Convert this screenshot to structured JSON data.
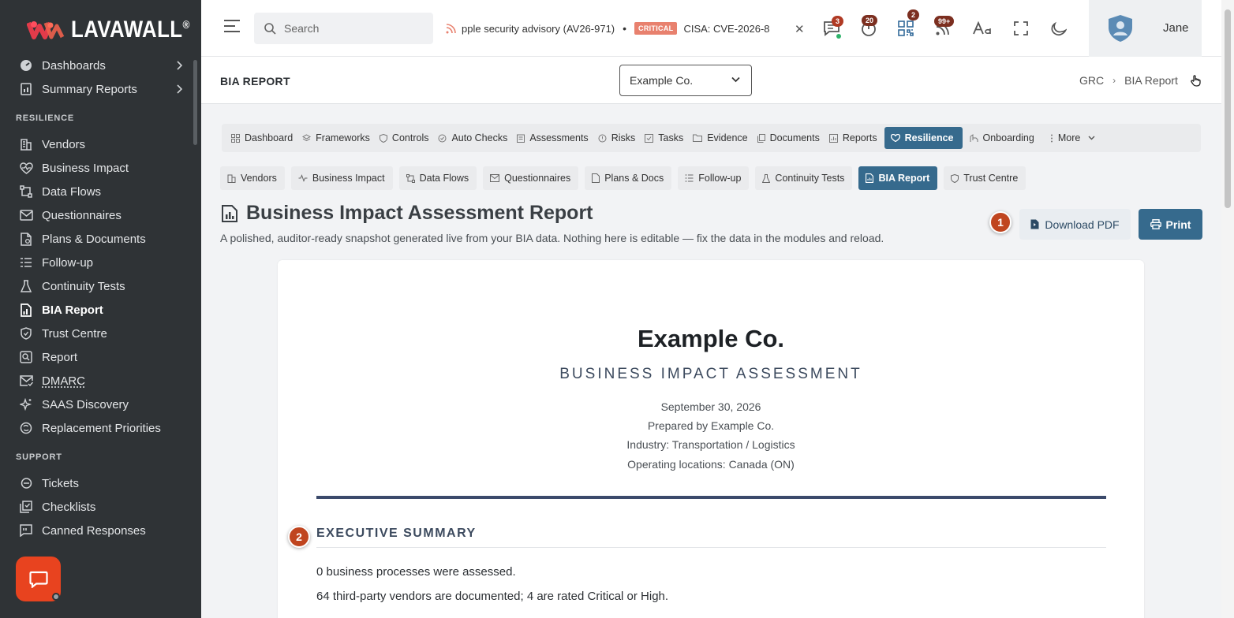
{
  "app": {
    "brand": "LAVAWALL",
    "brand_reg": "®"
  },
  "sidebar": {
    "top_items": [
      {
        "label": "Dashboards",
        "icon": "dashboard-icon"
      },
      {
        "label": "Summary Reports",
        "icon": "report-icon"
      }
    ],
    "resilience_heading": "RESILIENCE",
    "resilience_items": [
      {
        "label": "Vendors",
        "icon": "building-icon"
      },
      {
        "label": "Business Impact",
        "icon": "heart-pulse-icon"
      },
      {
        "label": "Data Flows",
        "icon": "flow-icon"
      },
      {
        "label": "Questionnaires",
        "icon": "envelope-icon"
      },
      {
        "label": "Plans & Documents",
        "icon": "document-icon"
      },
      {
        "label": "Follow-up",
        "icon": "list-icon"
      },
      {
        "label": "Continuity Tests",
        "icon": "flask-icon"
      },
      {
        "label": "BIA Report",
        "icon": "report-chart-icon",
        "active": true
      },
      {
        "label": "Trust Centre",
        "icon": "shield-icon"
      },
      {
        "label": "Report",
        "icon": "magnifier-icon"
      },
      {
        "label": "DMARC",
        "icon": "mail-check-icon"
      },
      {
        "label": "SAAS Discovery",
        "icon": "sparkle-icon"
      },
      {
        "label": "Replacement Priorities",
        "icon": "cycle-icon"
      }
    ],
    "support_heading": "SUPPORT",
    "support_items": [
      {
        "label": "Tickets",
        "icon": "ticket-icon"
      },
      {
        "label": "Checklists",
        "icon": "checklist-icon"
      },
      {
        "label": "Canned Responses",
        "icon": "chat-quote-icon"
      }
    ]
  },
  "topbar": {
    "search_placeholder": "Search",
    "ticker_item_1": "pple security advisory (AV26-971)",
    "ticker_dot": "•",
    "ticker_badge": "CRITICAL",
    "ticker_item_2": "CISA: CVE-2026-8",
    "ticker_close": "✕",
    "badge_messages": "3",
    "badge_timer": "20",
    "badge_qr": "2",
    "badge_feed": "99+",
    "user_name": "Jane"
  },
  "header": {
    "page_label": "BIA REPORT",
    "company_selected": "Example Co.",
    "breadcrumb_root": "GRC",
    "breadcrumb_sep": "›",
    "breadcrumb_current": "BIA Report"
  },
  "main_tabs": [
    {
      "label": "Dashboard"
    },
    {
      "label": "Frameworks"
    },
    {
      "label": "Controls"
    },
    {
      "label": "Auto Checks"
    },
    {
      "label": "Assessments"
    },
    {
      "label": "Risks"
    },
    {
      "label": "Tasks"
    },
    {
      "label": "Evidence"
    },
    {
      "label": "Documents"
    },
    {
      "label": "Reports"
    },
    {
      "label": "Resilience",
      "active": true
    },
    {
      "label": "Onboarding"
    },
    {
      "label": "More"
    }
  ],
  "sub_tabs": [
    {
      "label": "Vendors"
    },
    {
      "label": "Business Impact"
    },
    {
      "label": "Data Flows"
    },
    {
      "label": "Questionnaires"
    },
    {
      "label": "Plans & Docs"
    },
    {
      "label": "Follow-up"
    },
    {
      "label": "Continuity Tests"
    },
    {
      "label": "BIA Report",
      "active": true
    },
    {
      "label": "Trust Centre"
    }
  ],
  "report": {
    "title": "Business Impact Assessment Report",
    "subtitle": "A polished, auditor-ready snapshot generated live from your BIA data. Nothing here is editable — fix the data in the modules and reload.",
    "step1": "1",
    "step2": "2",
    "download_label": "Download PDF",
    "print_label": "Print",
    "company": "Example Co.",
    "heading": "BUSINESS IMPACT ASSESSMENT",
    "date": "September 30, 2026",
    "prepared_by": "Prepared by Example Co.",
    "industry": "Industry: Transportation / Logistics",
    "locations": "Operating locations: Canada (ON)",
    "exec_title": "EXECUTIVE SUMMARY",
    "summary_1": "0 business processes were assessed.",
    "summary_2": "64 third-party vendors are documented; 4 are rated Critical or High."
  },
  "colors": {
    "sidebar_bg": "#2f3336",
    "accent": "#366a8d",
    "brand_red": "#e8431f",
    "badge": "#b03a24"
  }
}
